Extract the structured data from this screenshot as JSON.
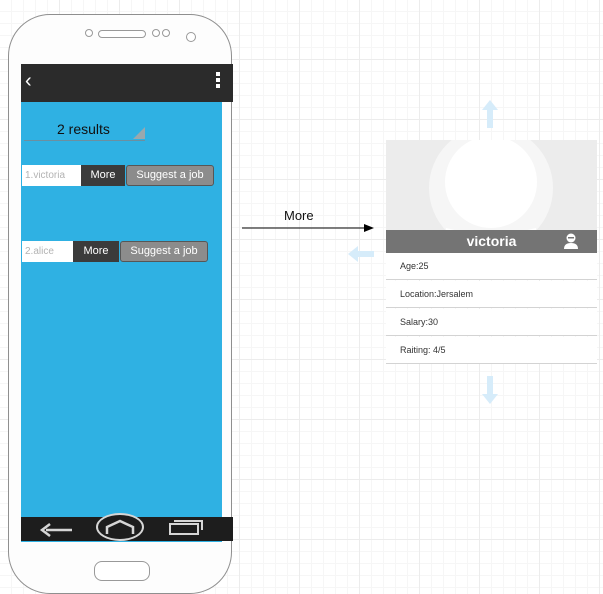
{
  "phone": {
    "results_label": "2 results",
    "rows": [
      {
        "name": "1.victoria",
        "more": "More",
        "suggest": "Suggest a job"
      },
      {
        "name": "2.alice",
        "more": "More",
        "suggest": "Suggest a job"
      }
    ]
  },
  "connector": {
    "label": "More"
  },
  "profile": {
    "name": "victoria",
    "fields": [
      "Age:25",
      "Location:Jersalem",
      "Salary:30",
      "Raiting: 4/5"
    ]
  },
  "colors": {
    "screen": "#2fb1e3",
    "bars": "#2b2b2b",
    "card_namebar": "#747474",
    "hint_arrows": "#d6ecfa"
  }
}
